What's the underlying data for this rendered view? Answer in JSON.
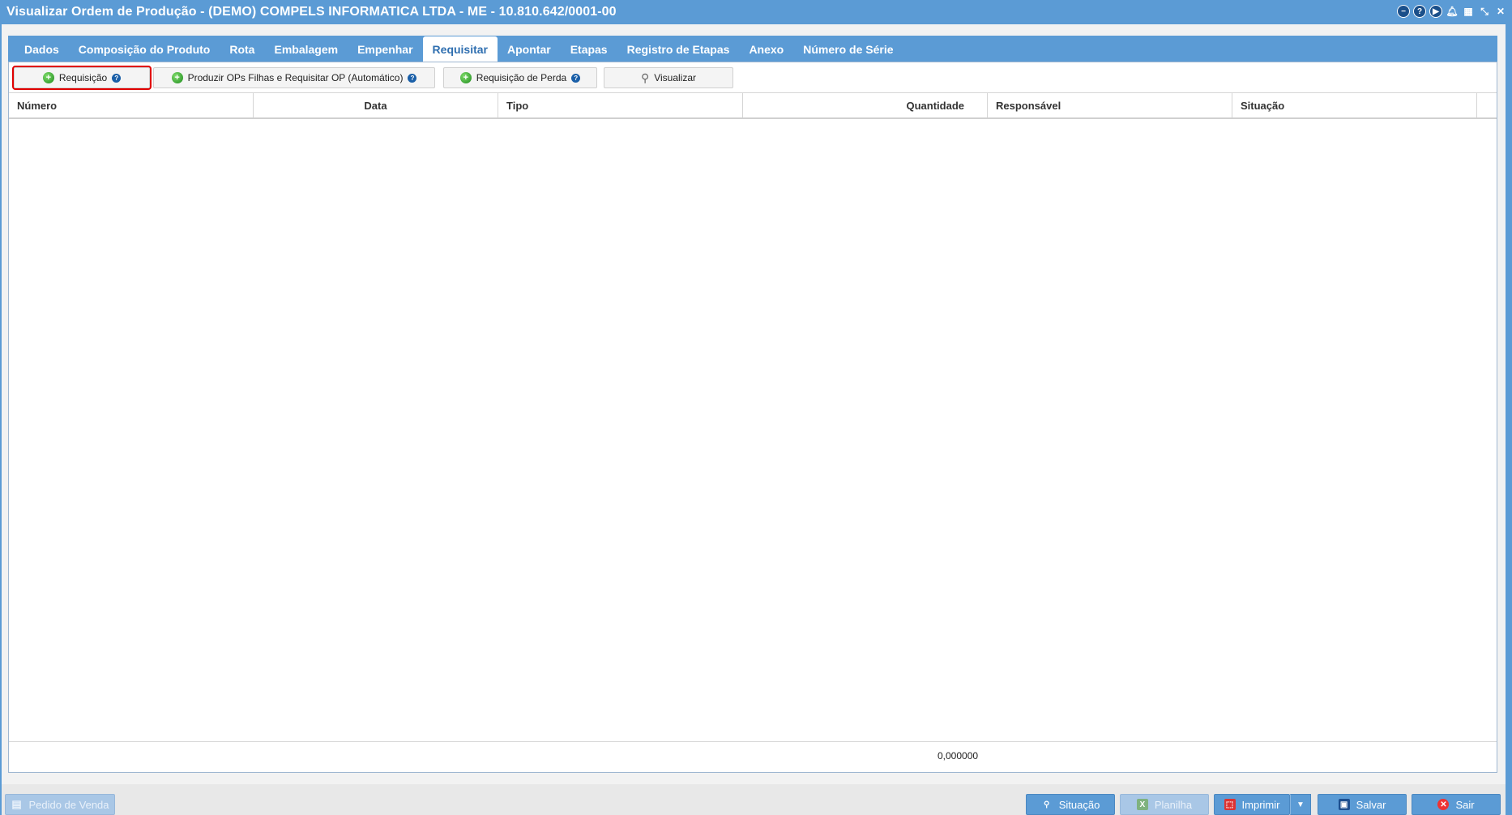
{
  "window": {
    "title": "Visualizar Ordem de Produção - (DEMO) COMPELS INFORMATICA LTDA - ME - 10.810.642/0001-00",
    "icons": [
      "minimize-icon",
      "help-icon",
      "play-icon",
      "bell-icon",
      "calendar-icon",
      "compress-icon",
      "close-icon"
    ]
  },
  "tabs": [
    {
      "label": "Dados"
    },
    {
      "label": "Composição do Produto"
    },
    {
      "label": "Rota"
    },
    {
      "label": "Embalagem"
    },
    {
      "label": "Empenhar"
    },
    {
      "label": "Requisitar",
      "active": true
    },
    {
      "label": "Apontar"
    },
    {
      "label": "Etapas"
    },
    {
      "label": "Registro de Etapas"
    },
    {
      "label": "Anexo"
    },
    {
      "label": "Número de Série"
    }
  ],
  "toolbar": {
    "requisicao": "Requisição",
    "produzir": "Produzir OPs Filhas e Requisitar OP (Automático)",
    "perda": "Requisição de Perda",
    "visualizar": "Visualizar"
  },
  "table": {
    "columns": [
      "Número",
      "Data",
      "Tipo",
      "Quantidade",
      "Responsável",
      "Situação"
    ],
    "rows": [],
    "total_quantidade": "0,000000"
  },
  "bottom": {
    "pedido_venda": "Pedido de Venda",
    "situacao": "Situação",
    "planilha": "Planilha",
    "imprimir": "Imprimir",
    "salvar": "Salvar",
    "sair": "Sair"
  },
  "colors": {
    "accent": "#5b9bd5",
    "highlight": "#e00000"
  }
}
